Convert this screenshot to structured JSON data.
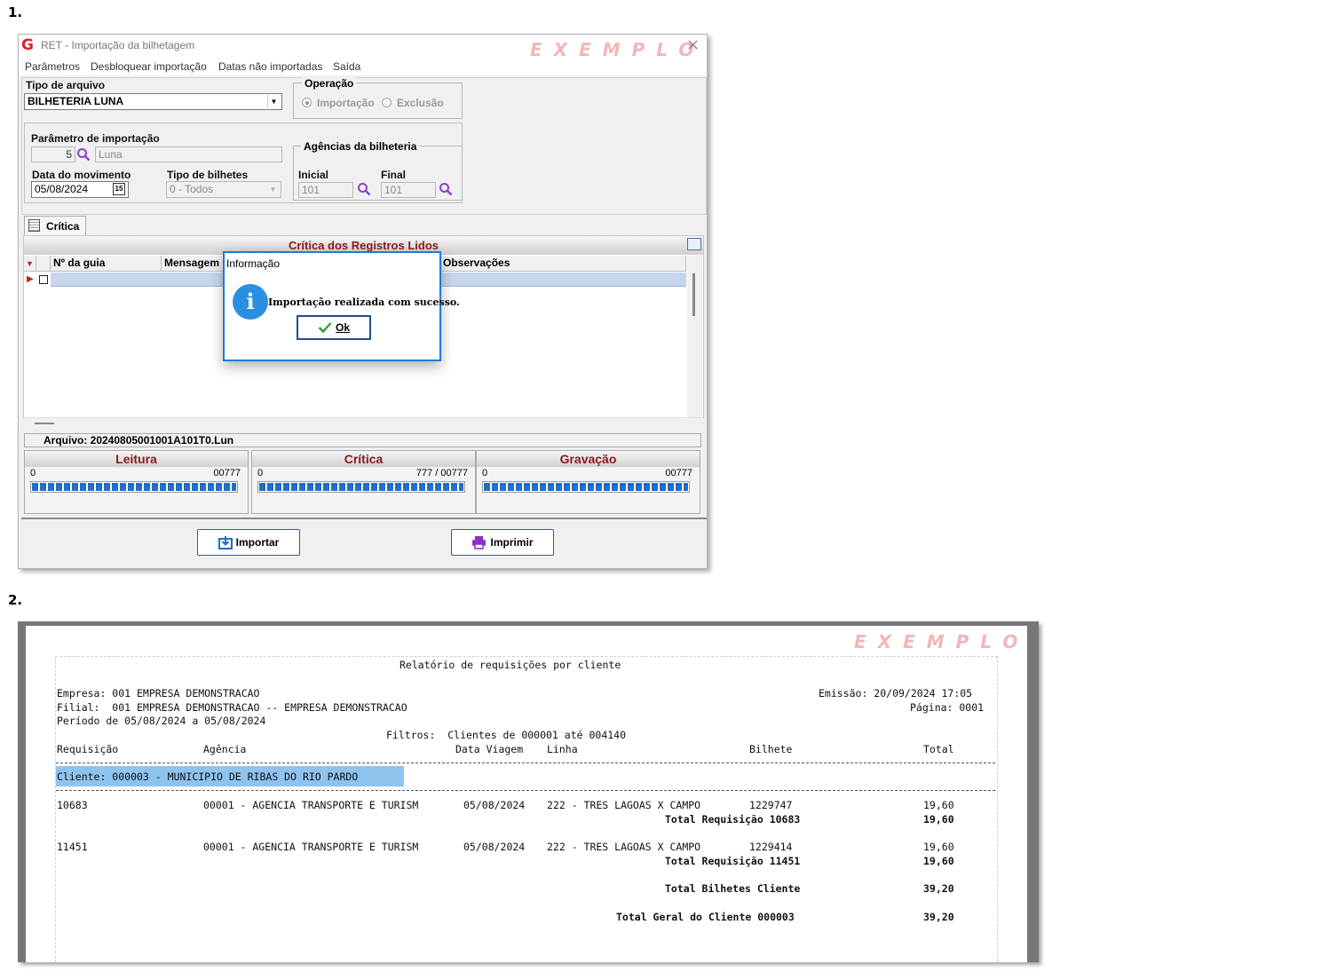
{
  "labels": {
    "step1": "1.",
    "step2": "2.",
    "watermark": "EXEMPLO"
  },
  "window": {
    "title": "RET - Importação da bilhetagem",
    "menu": [
      "Parâmetros",
      "Desbloquear importação",
      "Datas não importadas",
      "Saída"
    ]
  },
  "form": {
    "tipo_arquivo_label": "Tipo de arquivo",
    "tipo_arquivo_value": "BILHETERIA LUNA",
    "operacao_label": "Operação",
    "op_importacao": "Importação",
    "op_exclusao": "Exclusão",
    "param_label": "Parâmetro de importação",
    "param_code": "5",
    "param_name": "Luna",
    "data_mov_label": "Data do movimento",
    "data_mov_value": "05/08/2024",
    "tipo_bilhetes_label": "Tipo de bilhetes",
    "tipo_bilhetes_value": "0 - Todos",
    "agencias_label": "Agências da bilheteria",
    "inicial_label": "Inicial",
    "inicial_value": "101",
    "final_label": "Final",
    "final_value": "101"
  },
  "tab": {
    "label": "Crítica"
  },
  "grid": {
    "title": "Crítica dos Registros Lidos",
    "columns": [
      "Nº da guia",
      "Mensagem",
      "Observações"
    ]
  },
  "file": {
    "label": "Arquivo: 20240805001001A101T0.Lun"
  },
  "progress": [
    {
      "title": "Leitura",
      "low": "0",
      "high": "00777",
      "fraction": 1.0
    },
    {
      "title": "Crítica",
      "low": "0",
      "high": "777 / 00777",
      "fraction": 1.0
    },
    {
      "title": "Gravação",
      "low": "0",
      "high": "00777",
      "fraction": 1.0
    }
  ],
  "buttons": {
    "importar": "Importar",
    "imprimir": "Imprimir"
  },
  "dialog": {
    "title": "Informação",
    "message": "Importação realizada com sucesso.",
    "ok": "Ok"
  },
  "report": {
    "title": "Relatório de requisições por cliente",
    "empresa": "Empresa: 001 EMPRESA DEMONSTRACAO",
    "emissao": "Emissão: 20/09/2024 17:05",
    "filial": "Filial:  001 EMPRESA DEMONSTRACAO -- EMPRESA DEMONSTRACAO",
    "pagina": "Página: 0001",
    "periodo": "Período de 05/08/2024 a 05/08/2024",
    "filtros": "Filtros:  Clientes de 000001 até 004140",
    "headers": {
      "requisicao": "Requisição",
      "agencia": "Agência",
      "data": "Data Viagem",
      "linha": "Linha",
      "bilhete": "Bilhete",
      "total": "Total"
    },
    "cliente": "Cliente: 000003 - MUNICIPIO DE RIBAS DO RIO PARDO",
    "rows": [
      {
        "req": "10683",
        "agencia": "00001 - AGENCIA TRANSPORTE E TURISM",
        "data": "05/08/2024",
        "linha": "222 - TRES LAGOAS X CAMPO",
        "bilhete": "1229747",
        "valor": "19,60",
        "total_label": "Total Requisição 10683",
        "total_valor": "19,60"
      },
      {
        "req": "11451",
        "agencia": "00001 - AGENCIA TRANSPORTE E TURISM",
        "data": "05/08/2024",
        "linha": "222 - TRES LAGOAS X CAMPO",
        "bilhete": "1229414",
        "valor": "19,60",
        "total_label": "Total Requisição 11451",
        "total_valor": "19,60"
      }
    ],
    "total_bilhetes_label": "Total Bilhetes Cliente",
    "total_bilhetes_valor": "39,20",
    "total_geral_label": "Total Geral do Cliente 000003",
    "total_geral_valor": "39,20"
  }
}
